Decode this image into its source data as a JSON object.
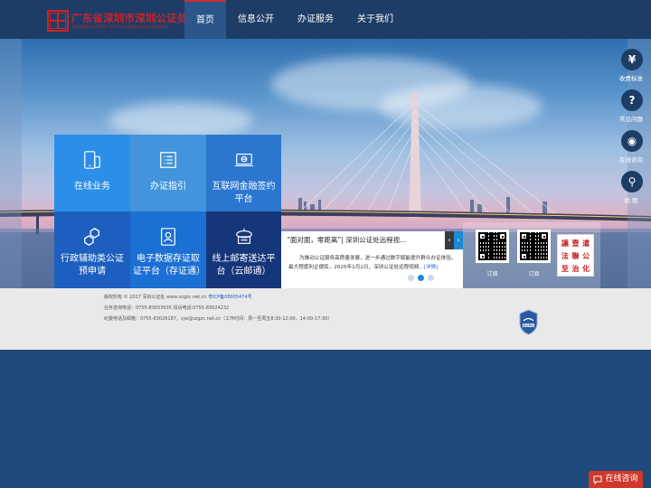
{
  "header": {
    "logo_cn": "广东省深圳市深圳公证处",
    "logo_en": "SHENZHEN NOTARY OFFICE SHENZHEN GUANGDONG",
    "nav": [
      "首页",
      "信息公开",
      "办证服务",
      "关于我们"
    ]
  },
  "tiles": [
    "在线业务",
    "办证指引",
    "互联网金融签约平台",
    "行政辅助类公证预申请",
    "电子数据存证取证平台（存证通）",
    "线上邮寄送达平台（云邮通）"
  ],
  "news": {
    "title": "“面对面，零距离”| 深圳公证处远程视...",
    "prev": "‹",
    "next": "›",
    "desc": "为推动公证服务高质量发展，进一步通过数字赋能提升群众办证体验，最大程度利企便民，2025年1月2日，深圳公证处远程视频...",
    "more": "[详情]"
  },
  "qr": {
    "label1": "订阅",
    "label2": "订阅"
  },
  "seal_chars": [
    "讓",
    "壹",
    "遣",
    "法",
    "聯",
    "公",
    "至",
    "治",
    "化"
  ],
  "side": [
    {
      "icon": "¥",
      "label": "收费标准"
    },
    {
      "icon": "?",
      "label": "常见问题"
    },
    {
      "icon": "◉",
      "label": "在线咨询"
    },
    {
      "icon": "⚲",
      "label": "地 图"
    }
  ],
  "footer": {
    "copyright": "版权所有 © 2017 深圳公证处 www.szgzc.net.cn",
    "icp": "粤ICP备08005474号",
    "phones": "业务咨询电话：0755-83053935  投诉电话:0755-83024232",
    "contact": "纪委电话及邮箱：0755-83026187，cjw@szgzc.net.cn（工作时间：周一至周五8:30-12:00，14:00-17:30）",
    "badge": "事业单位"
  },
  "chat_label": "在线咨询"
}
